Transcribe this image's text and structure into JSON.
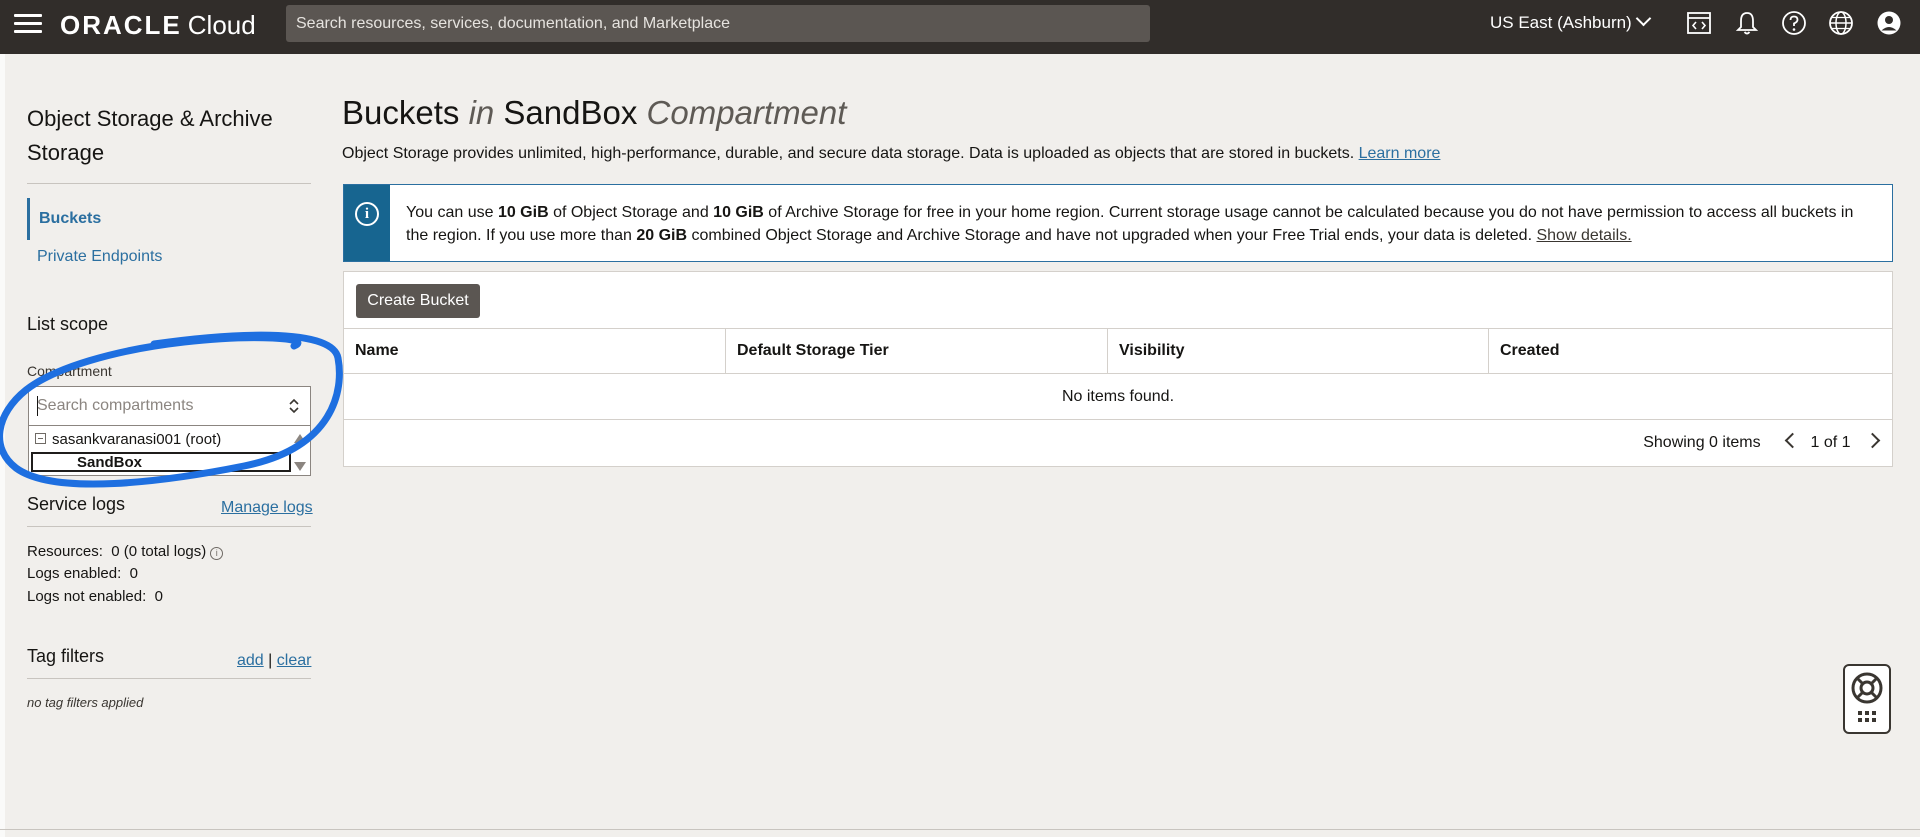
{
  "header": {
    "logo_brand": "ORACLE",
    "logo_product": "Cloud",
    "search_placeholder": "Search resources, services, documentation, and Marketplace",
    "region": "US East (Ashburn)"
  },
  "sidebar": {
    "title": "Object Storage & Archive Storage",
    "nav": [
      {
        "label": "Buckets",
        "active": true
      },
      {
        "label": "Private Endpoints",
        "active": false
      }
    ],
    "list_scope": "List scope",
    "compartment_label": "Compartment",
    "compartment_search_placeholder": "Search compartments",
    "compartment_tree": {
      "root": "sasankvaranasi001 (root)",
      "selected": "SandBox"
    },
    "service_logs": {
      "heading": "Service logs",
      "manage_link": "Manage logs",
      "resources_label": "Resources:",
      "resources_value": "0 (0 total logs)",
      "enabled_label": "Logs enabled:",
      "enabled_value": "0",
      "not_enabled_label": "Logs not enabled:",
      "not_enabled_value": "0"
    },
    "tag_filters": {
      "heading": "Tag filters",
      "add": "add",
      "separator": "|",
      "clear": "clear",
      "empty_text": "no tag filters applied"
    }
  },
  "main": {
    "title_part1": "Buckets",
    "title_in": "in",
    "title_compartment": "SandBox",
    "title_suffix": "Compartment",
    "description": "Object Storage provides unlimited, high-performance, durable, and secure data storage. Data is uploaded as objects that are stored in buckets.",
    "learn_more": "Learn more",
    "alert": {
      "t1": "You can use ",
      "b1": "10 GiB",
      "t2": " of Object Storage and ",
      "b2": "10 GiB",
      "t3": " of Archive Storage for free in your home region. Current storage usage cannot be calculated because you do not have permission to access all buckets in the region. If you use more than ",
      "b3": "20 GiB",
      "t4": " combined Object Storage and Archive Storage and have not upgraded when your Free Trial ends, your data is deleted. ",
      "show_details": "Show details."
    },
    "create_button": "Create Bucket",
    "table": {
      "columns": [
        "Name",
        "Default Storage Tier",
        "Visibility",
        "Created"
      ],
      "empty_text": "No items found.",
      "showing": "Showing 0 items",
      "page": "1 of 1"
    }
  },
  "colors": {
    "topbar": "#312d2a",
    "link": "#2b6fa0",
    "alert_accent": "#176590",
    "annotation": "#1e6fe0"
  }
}
